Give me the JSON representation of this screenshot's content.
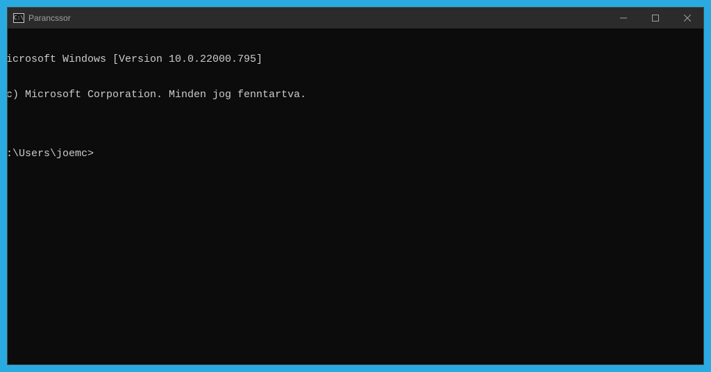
{
  "window": {
    "title": "Parancssor"
  },
  "terminal": {
    "line1": "icrosoft Windows [Version 10.0.22000.795]",
    "line2": "c) Microsoft Corporation. Minden jog fenntartva.",
    "blank": "",
    "prompt": ":\\Users\\joemc>"
  }
}
